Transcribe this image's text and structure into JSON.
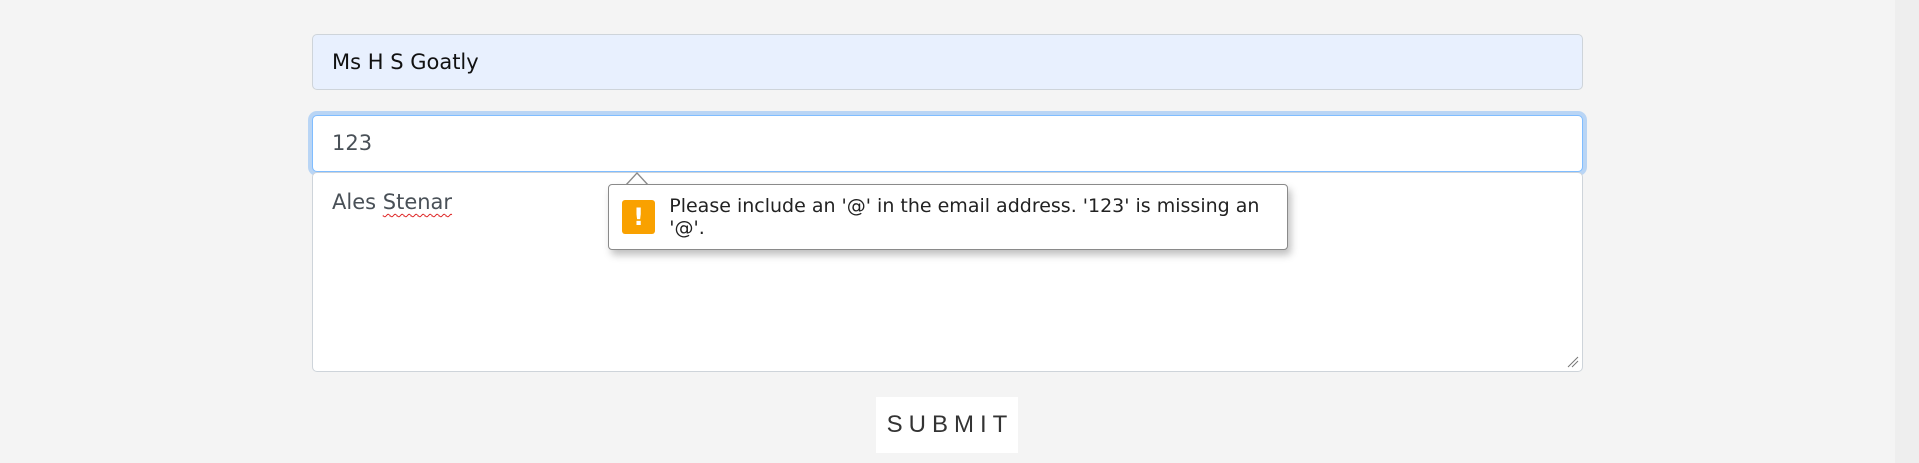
{
  "form": {
    "name_value": "Ms H S Goatly",
    "email_value": "123",
    "message_value_first": "Ales ",
    "message_value_misspelled": "Stenar",
    "submit_label": "SUBMIT"
  },
  "validation_tooltip": {
    "icon": "warning-icon",
    "icon_glyph": "!",
    "message": "Please include an '@' in the email address. '123' is missing an '@'.",
    "icon_color": "#f9a100"
  }
}
